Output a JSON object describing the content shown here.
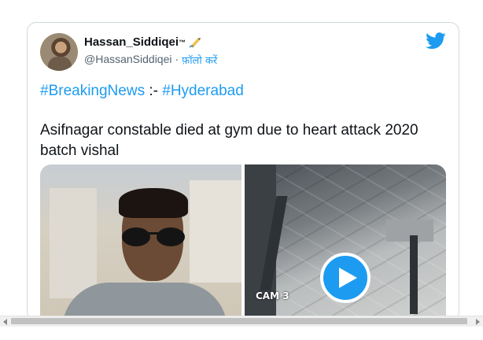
{
  "tweet": {
    "author_name": "Hassan_Siddiqei",
    "name_suffix": "™",
    "handle": "@HassanSiddiqei",
    "separator": "·",
    "follow_label": "फ़ॉलो करें",
    "hashtag_1": "#BreakingNews",
    "hashtag_separator": " :- ",
    "hashtag_2": "#Hyderabad",
    "text": "Asifnagar constable died at gym due to heart attack 2020 batch vishal",
    "video_overlay_label": "CAM 3"
  },
  "icons": {
    "brand": "twitter-bird-icon",
    "badge": "writing-hand-emoji-icon",
    "video": "play-icon"
  },
  "colors": {
    "accent": "#1d9bf0",
    "text": "#0f1419",
    "muted": "#536471",
    "border": "#cfd9de"
  }
}
